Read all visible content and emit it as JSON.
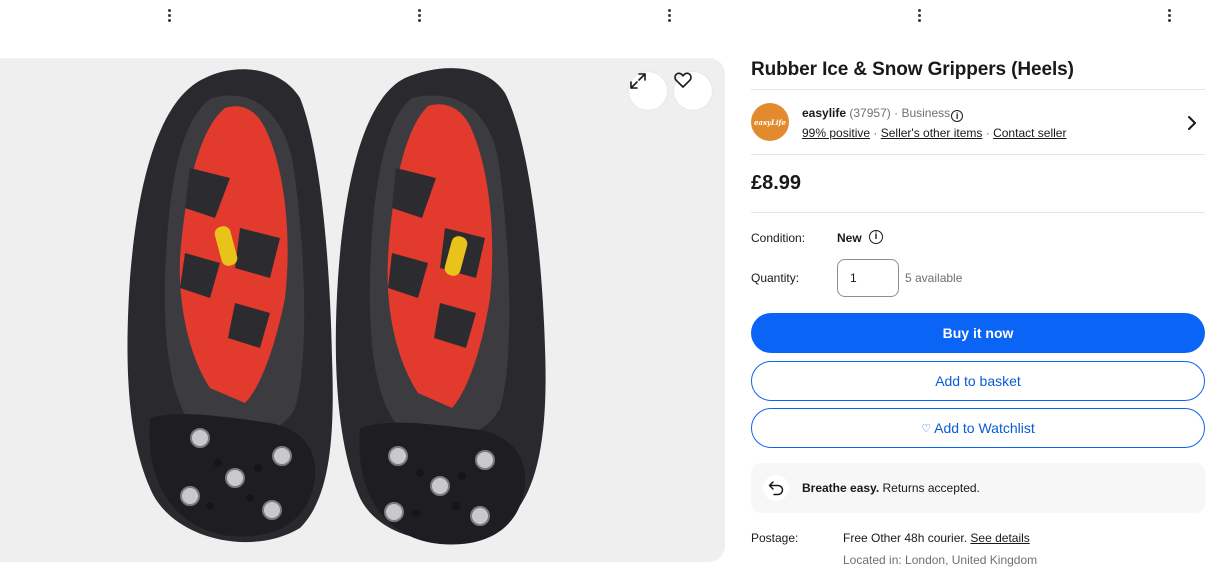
{
  "listing": {
    "title": "Rubber Ice & Snow Grippers (Heels)",
    "price": "£8.99"
  },
  "gallery": {
    "expand_icon": "expand-arrows-icon",
    "watch_icon": "heart-icon"
  },
  "seller": {
    "logo_text": "easyLife",
    "name": "easylife",
    "feedback_count": "(37957)",
    "separator": "·",
    "type": "Business",
    "positive": "99% positive",
    "other_items": "Seller's other items",
    "contact": "Contact seller"
  },
  "condition": {
    "label": "Condition:",
    "value": "New"
  },
  "quantity": {
    "label": "Quantity:",
    "value": "1",
    "available": "5 available"
  },
  "buttons": {
    "buy_now": "Buy it now",
    "add_to_basket": "Add to basket",
    "add_to_watchlist": "Add to Watchlist"
  },
  "returns": {
    "bold": "Breathe easy.",
    "text": " Returns accepted."
  },
  "postage": {
    "label": "Postage:",
    "value": "Free Other 48h courier. ",
    "details_link": "See details",
    "location": "Located in: London, United Kingdom"
  },
  "colors": {
    "primary_blue": "#0a64f5",
    "seller_logo": "#e38a2e",
    "sole_red": "#e23b2e"
  }
}
